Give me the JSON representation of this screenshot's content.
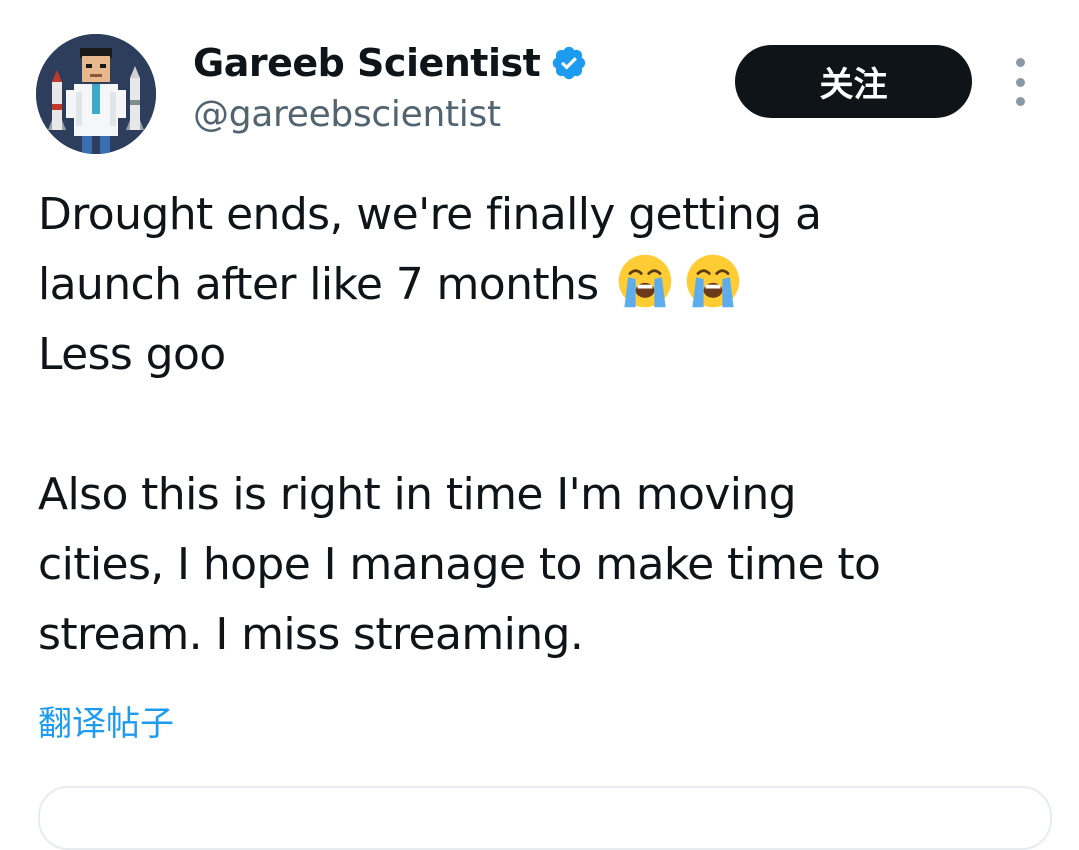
{
  "author": {
    "display_name": "Gareeb Scientist",
    "handle": "@gareebscientist",
    "verified": true,
    "avatar_icon": "scientist-avatar"
  },
  "actions": {
    "follow_label": "关注",
    "more_icon": "more-vertical-icon"
  },
  "tweet": {
    "lines": [
      "Drought ends, we're finally getting a",
      "launch after like 7 months",
      "Less goo",
      "",
      "Also this is right in time I'm moving",
      "cities, I hope I manage to make time to",
      "stream. I miss streaming."
    ],
    "emoji_icon": "loudly-crying-face-icon",
    "emoji_count": 2,
    "translate_label": "翻译帖子"
  },
  "colors": {
    "text": "#0f1419",
    "secondary": "#536471",
    "link": "#1d9bf0",
    "verified": "#1d9bf0",
    "button_bg": "#0f1419",
    "button_text": "#ffffff",
    "emoji": "#ffcc33",
    "tear": "#5dadec"
  }
}
